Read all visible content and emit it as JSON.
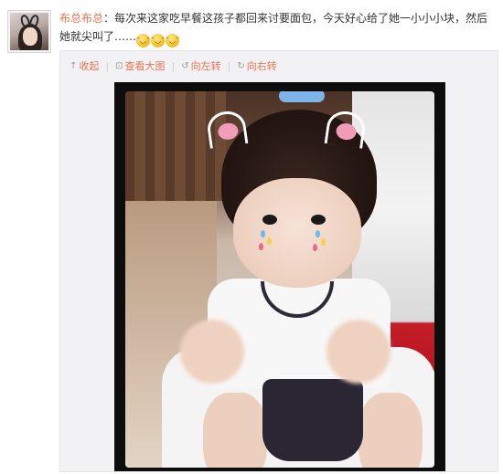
{
  "post": {
    "author": "布总布总",
    "colon": "：",
    "text": "每次来这家吃早餐这孩子都回来讨要面包，今天好心给了她一小小小块，然后她就尖叫了……",
    "emojis": [
      "laugh-cry-emoji",
      "laugh-cry-emoji",
      "laugh-cry-emoji"
    ]
  },
  "toolbar": {
    "collapse_label": "收起",
    "view_large_label": "查看大图",
    "rotate_left_label": "向左转",
    "rotate_right_label": "向右转",
    "collapse_icon": "up-arrow-icon",
    "view_large_icon": "enlarge-icon",
    "rotate_left_icon": "rotate-left-icon",
    "rotate_right_icon": "rotate-right-icon"
  },
  "colors": {
    "author": "#eb7350",
    "link": "#eb7350",
    "panel_bg": "#f2f2f5",
    "text": "#333333"
  }
}
